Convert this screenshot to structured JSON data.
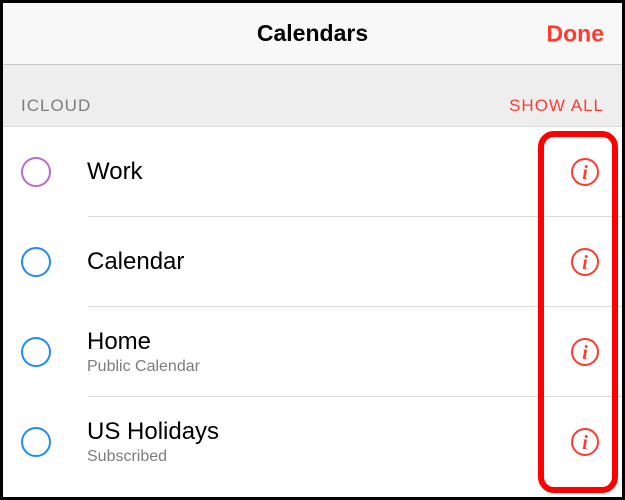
{
  "navbar": {
    "title": "Calendars",
    "done": "Done"
  },
  "section": {
    "label": "ICLOUD",
    "action": "SHOW ALL"
  },
  "calendars": [
    {
      "name": "Work",
      "subtitle": "",
      "colorClass": "check-purple"
    },
    {
      "name": "Calendar",
      "subtitle": "",
      "colorClass": "check-blue"
    },
    {
      "name": "Home",
      "subtitle": "Public Calendar",
      "colorClass": "check-blue"
    },
    {
      "name": "US Holidays",
      "subtitle": "Subscribed",
      "colorClass": "check-blue"
    }
  ]
}
